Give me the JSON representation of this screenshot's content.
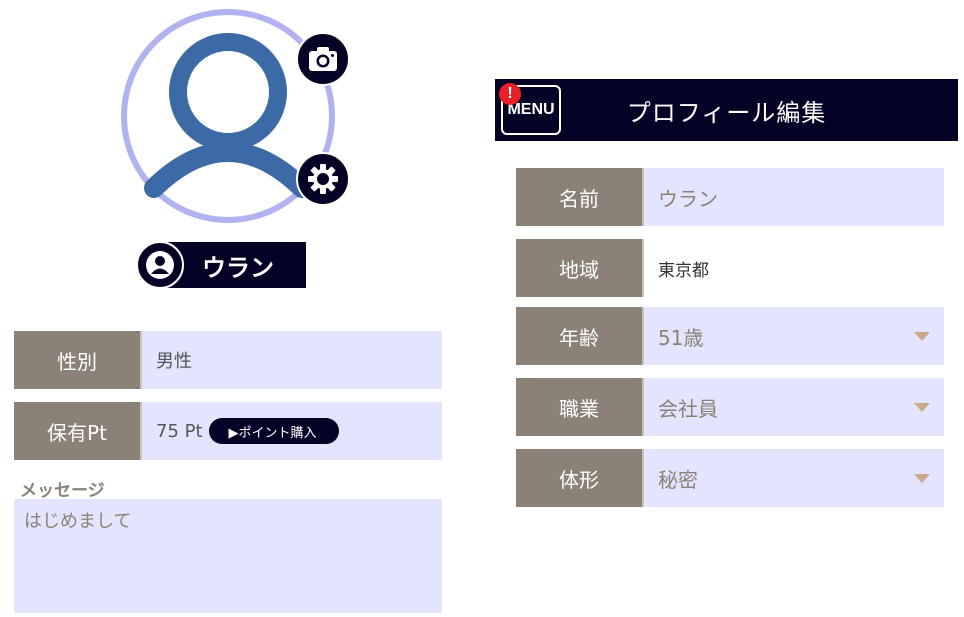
{
  "profile": {
    "name": "ウラン",
    "fields": [
      {
        "label": "性別",
        "value": "男性"
      },
      {
        "label": "保有Pt",
        "value": "75 Pt"
      }
    ],
    "buy_points_label": "▶ポイント購入",
    "message_label": "メッセージ",
    "message_value": "はじめまして"
  },
  "header": {
    "menu_label": "MENU",
    "alert_mark": "!",
    "title": "プロフィール編集"
  },
  "edit_fields": [
    {
      "label": "名前",
      "value": "ウラン"
    },
    {
      "label": "地域",
      "value": "東京都"
    },
    {
      "label": "年齢",
      "value": "51歳"
    },
    {
      "label": "職業",
      "value": "会社員"
    },
    {
      "label": "体形",
      "value": "秘密"
    }
  ],
  "colors": {
    "navy": "#040325",
    "label_bg": "#8b8176",
    "field_bg": "#e3e5ff",
    "avatar_blue": "#3b6aa6",
    "ring": "#b0b3f0",
    "alert": "#e8202a"
  },
  "icons": [
    "user-avatar-icon",
    "camera-icon",
    "gear-icon",
    "user-circle-icon",
    "alert-icon",
    "caret-down-icon"
  ]
}
